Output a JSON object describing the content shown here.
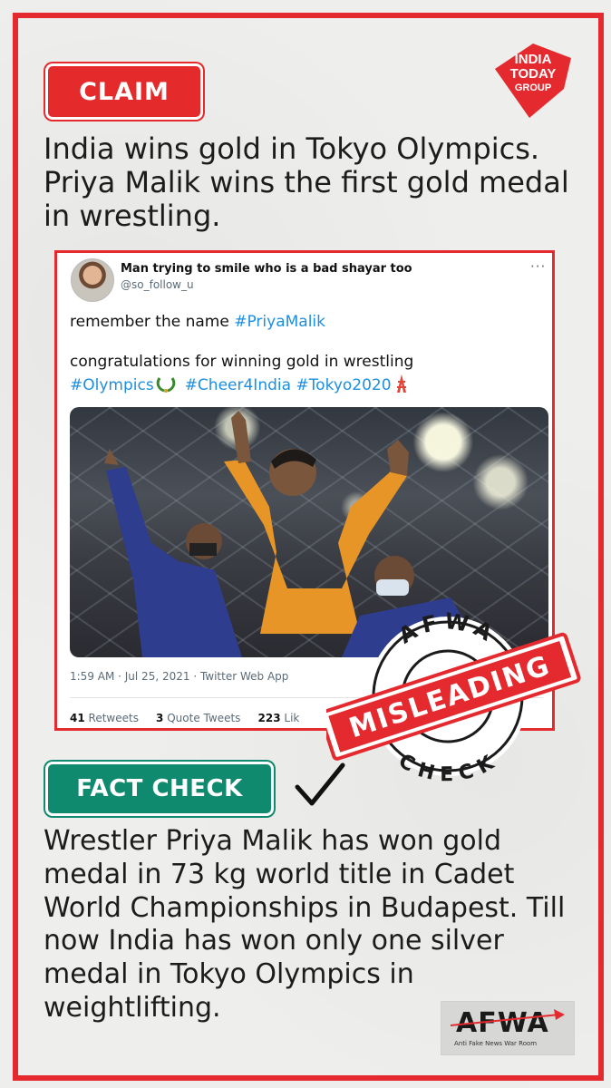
{
  "claim": {
    "label": "CLAIM",
    "text": "India wins gold in Tokyo Olympics. Priya Malik wins the first gold medal in wrestling."
  },
  "brand_logo": {
    "lines": [
      "INDIA",
      "TODAY",
      "GROUP"
    ],
    "color": "#e52a2f"
  },
  "tweet": {
    "display_name": "Man trying to smile who is a bad shayar too",
    "handle": "@so_follow_u",
    "more_icon": "more-dots-icon",
    "line1_text": "remember the name ",
    "line1_hashtag": "#PriyaMalik",
    "line2_text": "congratulations for winning gold in wrestling",
    "hashtag_olympics": "#Olympics",
    "hashtag_cheer": "#Cheer4India",
    "hashtag_tokyo": "#Tokyo2020",
    "timestamp": "1:59 AM · Jul 25, 2021 · Twitter Web App",
    "retweets_count": "41",
    "retweets_label": "Retweets",
    "quotes_count": "3",
    "quotes_label": "Quote Tweets",
    "likes_count": "223",
    "likes_label": "Lik",
    "link_color": "#1d8fe0"
  },
  "stamp": {
    "top": "AFWA",
    "middle": "MISLEADING",
    "bottom": "CHECK",
    "color": "#e52a2f"
  },
  "fact_check": {
    "label": "FACT CHECK",
    "text": "Wrestler Priya Malik has won gold medal in 73 kg world title in Cadet World Championships in Budapest. Till now India has won only one silver medal in Tokyo Olympics in weightlifting.",
    "color": "#0f8a6e"
  },
  "footer_logo": {
    "word": "AFWA",
    "subtitle": "Anti Fake News War Room"
  }
}
